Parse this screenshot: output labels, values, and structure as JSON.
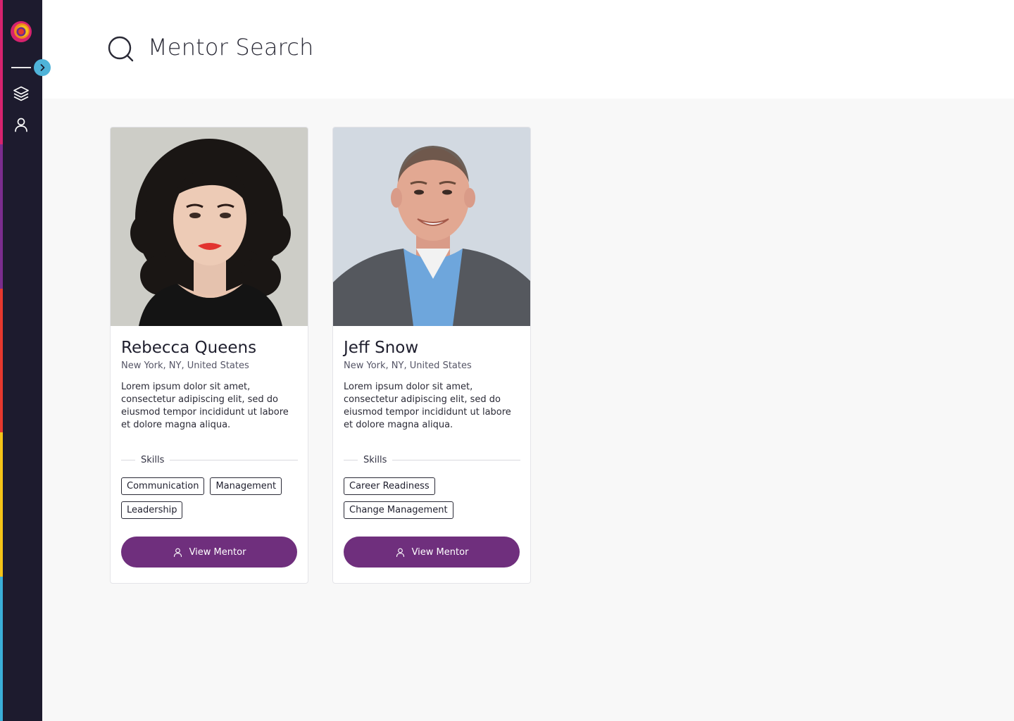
{
  "header": {
    "title": "Mentor Search"
  },
  "theme": {
    "sidebar_bg": "#1d1b2e",
    "accent_cyan": "#4fb3d9",
    "button_purple": "#6f2f7d",
    "strip_colors": [
      "#d6236e",
      "#7b2d8e",
      "#e6382e",
      "#f4c318",
      "#3aaed8"
    ]
  },
  "sidebar": {
    "items": [
      {
        "icon": "layers-icon"
      },
      {
        "icon": "user-icon"
      }
    ],
    "expand_icon": "chevron-right-icon"
  },
  "mentors": [
    {
      "name": "Rebecca Queens",
      "location": "New York, NY, United States",
      "bio": "Lorem ipsum dolor sit amet, consectetur adipiscing elit, sed do eiusmod tempor incididunt ut labore et dolore magna aliqua.",
      "skills_label": "Skills",
      "skills": [
        "Communication",
        "Management",
        "Leadership"
      ],
      "button_label": "View Mentor"
    },
    {
      "name": "Jeff Snow",
      "location": "New York, NY, United States",
      "bio": "Lorem ipsum dolor sit amet, consectetur adipiscing elit, sed do eiusmod tempor incididunt ut labore et dolore magna aliqua.",
      "skills_label": "Skills",
      "skills": [
        "Career Readiness",
        "Change Management"
      ],
      "button_label": "View Mentor"
    }
  ]
}
